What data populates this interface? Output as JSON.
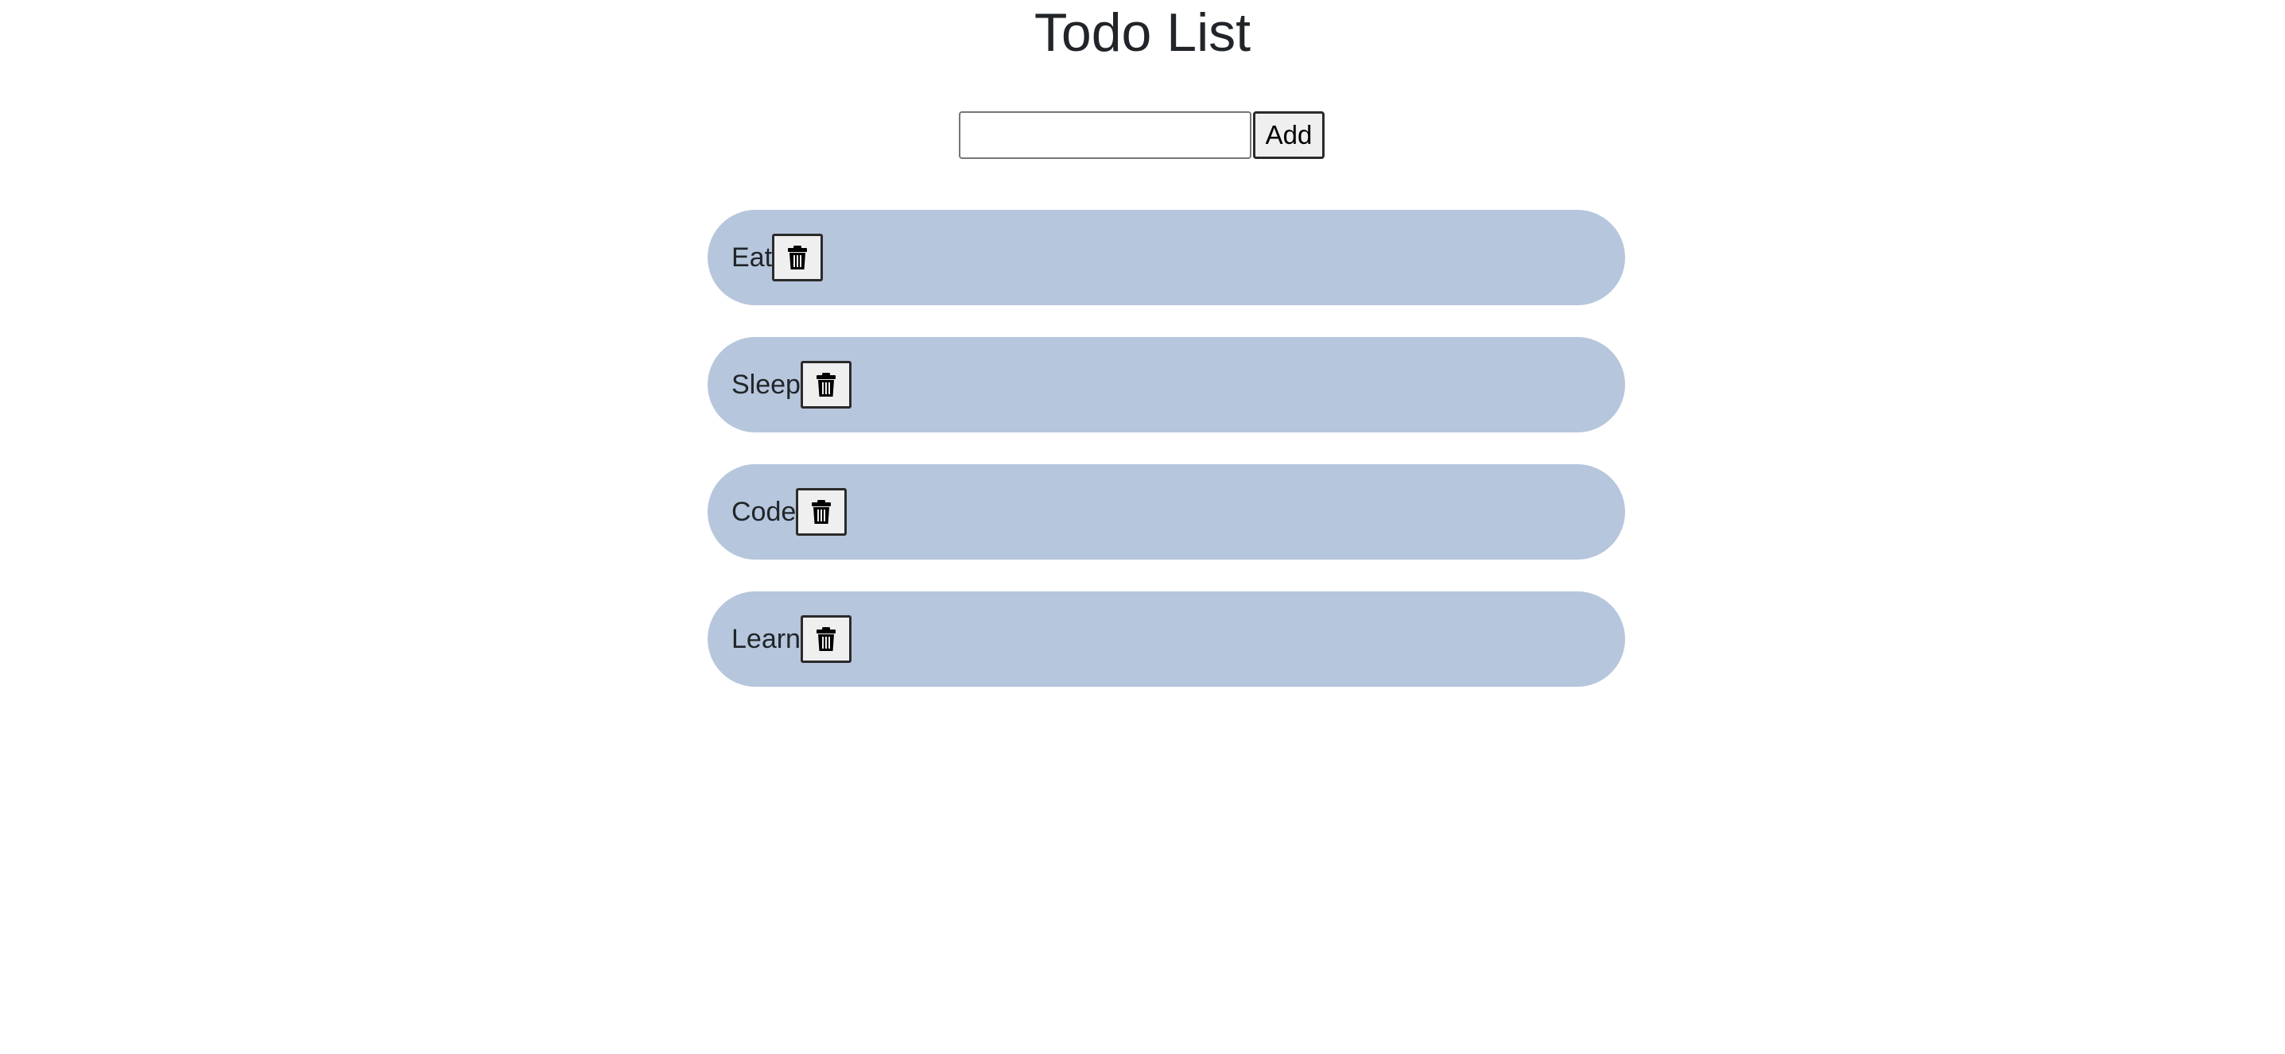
{
  "page": {
    "title": "Todo List"
  },
  "form": {
    "input_value": "",
    "input_placeholder": "",
    "add_label": "Add"
  },
  "todos": [
    {
      "text": "Eat",
      "delete_icon": "trash-icon"
    },
    {
      "text": "Sleep",
      "delete_icon": "trash-icon"
    },
    {
      "text": "Code",
      "delete_icon": "trash-icon"
    },
    {
      "text": "Learn",
      "delete_icon": "trash-icon"
    }
  ],
  "colors": {
    "item_background": "#b6c6dc",
    "text": "#212529",
    "button_background": "#efefef"
  }
}
